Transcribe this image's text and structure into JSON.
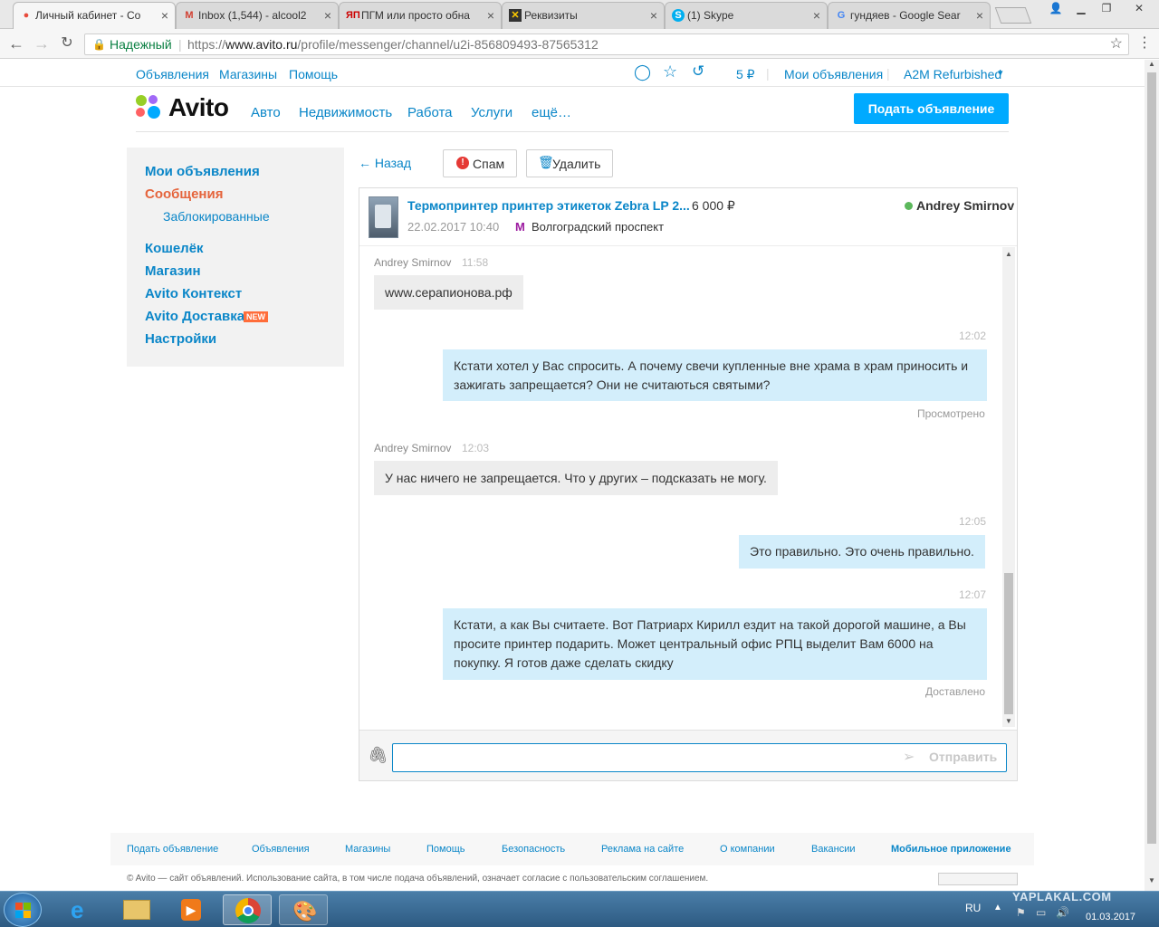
{
  "browser": {
    "tabs": [
      {
        "label": "Личный кабинет - Со",
        "icon": "avito-favicon",
        "active": true
      },
      {
        "label": "Inbox (1,544) - alcool2",
        "icon": "gmail-favicon"
      },
      {
        "label": "ПГМ или просто обна",
        "icon": "yaplakal-favicon"
      },
      {
        "label": "Реквизиты",
        "icon": "app-favicon"
      },
      {
        "label": "(1) Skype",
        "icon": "skype-favicon"
      },
      {
        "label": "гундяев - Google Sear",
        "icon": "google-favicon"
      }
    ],
    "secure_label": "Надежный",
    "url_prefix": "https://",
    "url_domain": "www.avito.ru",
    "url_path": "/profile/messenger/channel/u2i-856809493-87565312"
  },
  "site": {
    "top_links": [
      "Объявления",
      "Магазины",
      "Помощь"
    ],
    "balance": "5 ₽",
    "my_ads": "Мои объявления",
    "account": "A2M Refurbished",
    "logo": "Avito",
    "categories": [
      "Авто",
      "Недвижимость",
      "Работа",
      "Услуги",
      "ещё…"
    ],
    "post_button": "Подать объявление"
  },
  "sidebar": {
    "items": [
      {
        "label": "Мои объявления"
      },
      {
        "label": "Сообщения"
      },
      {
        "label": "Заблокированные"
      },
      {
        "label": "Кошелёк"
      },
      {
        "label": "Магазин"
      },
      {
        "label": "Avito Контекст"
      },
      {
        "label": "Avito Доставка"
      },
      {
        "label": "Настройки"
      }
    ],
    "new_badge": "NEW"
  },
  "actions": {
    "back": "← Назад",
    "spam": "Спам",
    "delete": "Удалить"
  },
  "listing": {
    "title": "Термопринтер принтер этикеток Zebra LP 2...",
    "price": "6 000 ₽",
    "date": "22.02.2017 10:40",
    "metro": "Волгоградский проспект",
    "seller": "Andrey Smirnov"
  },
  "messages": [
    {
      "author": "Andrey Smirnov",
      "time": "11:58",
      "text": "www.серапионова.рф"
    },
    {
      "time": "12:02",
      "line1": "Кстати хотел у Вас спросить. А почему свечи купленные вне храма в храм приносить и",
      "line2": "зажигать запрещается? Они не считаються святыми?",
      "status": "Просмотрено"
    },
    {
      "author": "Andrey Smirnov",
      "time": "12:03",
      "text": "У нас ничего не запрещается. Что у других – подсказать не могу."
    },
    {
      "time": "12:05",
      "text": "Это правильно. Это очень правильно."
    },
    {
      "time": "12:07",
      "line1": "Кстати, а как Вы считаете. Вот Патриарх Кирилл ездит на такой дорогой машине, а Вы",
      "line2": "просите принтер подарить. Может центральный офис РПЦ выделит Вам 6000 на",
      "line3": "покупку. Я готов даже сделать скидку",
      "status": "Доставлено"
    }
  ],
  "composer": {
    "value": "",
    "send": "Отправить"
  },
  "footer": {
    "links": [
      "Подать объявление",
      "Объявления",
      "Магазины",
      "Помощь",
      "Безопасность",
      "Реклама на сайте",
      "О компании",
      "Вакансии",
      "Мобильное приложение"
    ],
    "copyright": "© Avito — сайт объявлений. Использование сайта, в том числе подача объявлений, означает согласие с пользовательским соглашением."
  },
  "taskbar": {
    "lang": "RU",
    "date": "01.03.2017",
    "watermark": "YAPLAKAL.COM"
  }
}
